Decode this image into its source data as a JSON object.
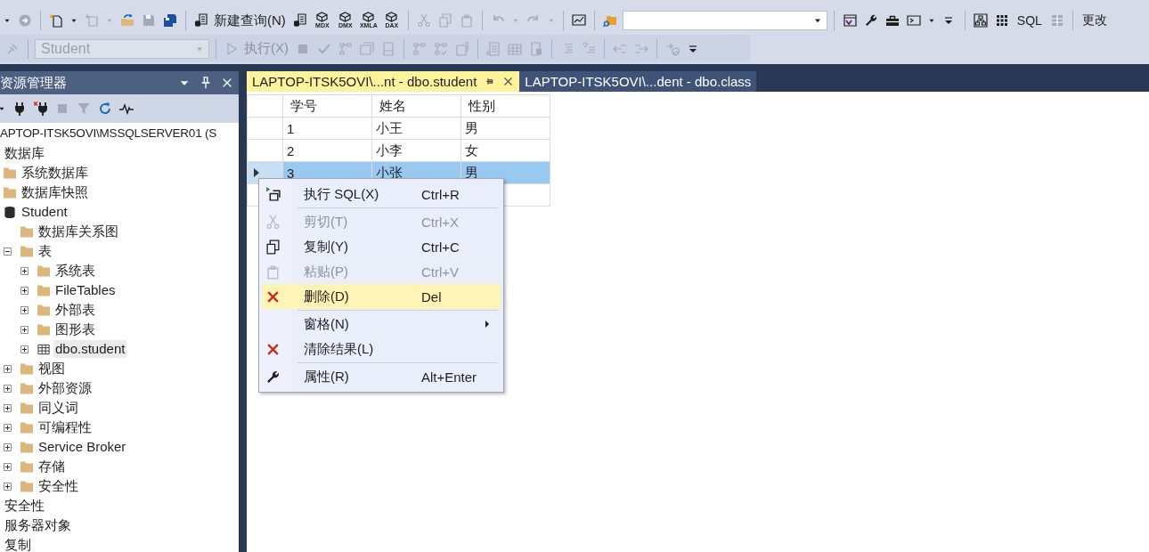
{
  "toolbars": [
    {
      "items": [
        {
          "kind": "caret",
          "disabled": false
        },
        {
          "kind": "forward-circle",
          "disabled": true
        },
        {
          "kind": "separator"
        },
        {
          "kind": "new-file",
          "disabled": false
        },
        {
          "kind": "caret",
          "disabled": false
        },
        {
          "kind": "add-item",
          "disabled": true
        },
        {
          "kind": "caret",
          "disabled": true
        },
        {
          "kind": "open-folder",
          "disabled": false
        },
        {
          "kind": "floppy-disk",
          "disabled": true
        },
        {
          "kind": "floppy-disks",
          "disabled": false
        },
        {
          "kind": "separator"
        },
        {
          "kind": "document-button",
          "label": "新建查询(N)",
          "disabled": false
        },
        {
          "kind": "document-db",
          "disabled": false
        },
        {
          "kind": "cube-button",
          "label": "MDX",
          "disabled": false
        },
        {
          "kind": "cube-button",
          "label": "DMX",
          "disabled": false
        },
        {
          "kind": "cube-button",
          "label": "XMLA",
          "disabled": false
        },
        {
          "kind": "cube-button",
          "label": "DAX",
          "disabled": false
        },
        {
          "kind": "separator"
        },
        {
          "kind": "scissors",
          "disabled": true
        },
        {
          "kind": "copy-pages",
          "disabled": true
        },
        {
          "kind": "clipboard",
          "disabled": true
        },
        {
          "kind": "separator"
        },
        {
          "kind": "undo-arrow",
          "disabled": true
        },
        {
          "kind": "caret",
          "disabled": true
        },
        {
          "kind": "redo-arrow",
          "disabled": true
        },
        {
          "kind": "caret",
          "disabled": true
        },
        {
          "kind": "separator"
        },
        {
          "kind": "monitor-chart",
          "disabled": false
        },
        {
          "kind": "separator"
        },
        {
          "kind": "search-folder",
          "disabled": false
        },
        {
          "kind": "combo",
          "disabled": false
        },
        {
          "kind": "separator"
        },
        {
          "kind": "window-logo",
          "disabled": false
        },
        {
          "kind": "wrench",
          "disabled": false
        },
        {
          "kind": "toolbox",
          "disabled": false
        },
        {
          "kind": "terminal",
          "disabled": false
        },
        {
          "kind": "caret",
          "disabled": false
        },
        {
          "kind": "overflow",
          "disabled": false
        },
        {
          "kind": "separator"
        },
        {
          "kind": "hierarchy",
          "disabled": false
        },
        {
          "kind": "dot-grid",
          "disabled": false
        },
        {
          "kind": "text-button",
          "label": "SQL",
          "disabled": false
        },
        {
          "kind": "grid-tile",
          "disabled": true
        },
        {
          "kind": "separator"
        },
        {
          "kind": "text-button",
          "label": "更改",
          "disabled": false
        }
      ]
    },
    {
      "items": [
        {
          "kind": "plug-tool",
          "disabled": true
        },
        {
          "kind": "separator"
        },
        {
          "kind": "combo",
          "value": "Student",
          "disabled": true
        },
        {
          "kind": "separator"
        },
        {
          "kind": "play-button",
          "label": "执行(X)",
          "disabled": true
        },
        {
          "kind": "stop-square",
          "disabled": true
        },
        {
          "kind": "checkmark",
          "disabled": true
        },
        {
          "kind": "flow-chart",
          "disabled": true
        },
        {
          "kind": "windows",
          "disabled": true
        },
        {
          "kind": "panel",
          "disabled": true
        },
        {
          "kind": "separator"
        },
        {
          "kind": "flow-chart",
          "disabled": true
        },
        {
          "kind": "flow-check",
          "disabled": true
        },
        {
          "kind": "panel-chart",
          "disabled": true
        },
        {
          "kind": "separator"
        },
        {
          "kind": "doc-list",
          "disabled": true
        },
        {
          "kind": "table-grid",
          "disabled": true
        },
        {
          "kind": "doc-link",
          "disabled": true
        },
        {
          "kind": "separator"
        },
        {
          "kind": "lines",
          "disabled": true
        },
        {
          "kind": "help-lines",
          "disabled": true
        },
        {
          "kind": "separator"
        },
        {
          "kind": "outdent",
          "disabled": true
        },
        {
          "kind": "indent",
          "disabled": true
        },
        {
          "kind": "separator"
        },
        {
          "kind": "at-arrow",
          "disabled": true
        },
        {
          "kind": "overflow",
          "disabled": false
        }
      ]
    }
  ],
  "explorer": {
    "title": "资源管理器",
    "toolbar": [
      {
        "kind": "caret",
        "disabled": false
      },
      {
        "kind": "plug",
        "disabled": false
      },
      {
        "kind": "plug-cross",
        "disabled": false
      },
      {
        "kind": "stop-square",
        "disabled": true
      },
      {
        "kind": "funnel",
        "disabled": true
      },
      {
        "kind": "refresh",
        "disabled": false
      },
      {
        "kind": "pulse",
        "disabled": false
      }
    ],
    "tree": [
      {
        "label": "APTOP-ITSK5OVI\\MSSQLSERVER01 (S",
        "selected": false,
        "children": [
          {
            "label": "数据库",
            "selected": false,
            "children": [
              {
                "label": "系统数据库",
                "kind": "folder",
                "selected": false
              },
              {
                "label": "数据库快照",
                "kind": "folder",
                "selected": false
              },
              {
                "label": "Student",
                "kind": "database",
                "selected": false,
                "children": [
                  {
                    "label": "数据库关系图",
                    "kind": "folder",
                    "selected": false
                  },
                  {
                    "label": "表",
                    "kind": "folder",
                    "selected": false,
                    "expanded": true,
                    "children": [
                      {
                        "label": "系统表",
                        "kind": "folder",
                        "selected": false,
                        "expanded": false
                      },
                      {
                        "label": "FileTables",
                        "kind": "folder",
                        "selected": false,
                        "expanded": false
                      },
                      {
                        "label": "外部表",
                        "kind": "folder",
                        "selected": false,
                        "expanded": false
                      },
                      {
                        "label": "图形表",
                        "kind": "folder",
                        "selected": false,
                        "expanded": false
                      },
                      {
                        "label": "dbo.student",
                        "kind": "table",
                        "selected": true,
                        "expanded": false
                      }
                    ]
                  },
                  {
                    "label": "视图",
                    "kind": "folder",
                    "selected": false,
                    "expanded": false
                  },
                  {
                    "label": "外部资源",
                    "kind": "folder",
                    "selected": false,
                    "expanded": false
                  },
                  {
                    "label": "同义词",
                    "kind": "folder",
                    "selected": false,
                    "expanded": false
                  },
                  {
                    "label": "可编程性",
                    "kind": "folder",
                    "selected": false,
                    "expanded": false
                  },
                  {
                    "label": "Service Broker",
                    "kind": "folder",
                    "selected": false,
                    "expanded": false
                  },
                  {
                    "label": "存储",
                    "kind": "folder",
                    "selected": false,
                    "expanded": false
                  },
                  {
                    "label": "安全性",
                    "kind": "folder",
                    "selected": false,
                    "expanded": false
                  }
                ]
              }
            ]
          },
          {
            "label": "安全性",
            "selected": false
          },
          {
            "label": "服务器对象",
            "selected": false
          },
          {
            "label": "复制",
            "selected": false
          }
        ]
      }
    ]
  },
  "tabs": [
    {
      "label": "LAPTOP-ITSK5OVI\\...nt - dbo.student",
      "selected": true
    },
    {
      "label": "LAPTOP-ITSK5OVI\\...dent - dbo.class",
      "selected": false
    }
  ],
  "grid": {
    "columns": [
      "学号",
      "姓名",
      "性别"
    ],
    "rows": [
      {
        "cells": [
          "1",
          "小王",
          "男"
        ],
        "selected": false
      },
      {
        "cells": [
          "2",
          "小李",
          "女"
        ],
        "selected": false
      },
      {
        "cells": [
          "3",
          "小张",
          "男"
        ],
        "selected": true
      }
    ]
  },
  "context_menu": {
    "items": [
      {
        "kind": "run",
        "label": "执行 SQL(X)",
        "shortcut": "Ctrl+R",
        "disabled": false,
        "selected": false
      },
      {
        "kind": "separator"
      },
      {
        "kind": "cut",
        "label": "剪切(T)",
        "shortcut": "Ctrl+X",
        "disabled": true,
        "selected": false
      },
      {
        "kind": "copy",
        "label": "复制(Y)",
        "shortcut": "Ctrl+C",
        "disabled": false,
        "selected": false
      },
      {
        "kind": "paste",
        "label": "粘贴(P)",
        "shortcut": "Ctrl+V",
        "disabled": true,
        "selected": false
      },
      {
        "kind": "delete",
        "label": "删除(D)",
        "shortcut": "Del",
        "disabled": false,
        "selected": true
      },
      {
        "kind": "separator"
      },
      {
        "kind": "submenu",
        "label": "窗格(N)",
        "disabled": false,
        "selected": false
      },
      {
        "kind": "clear",
        "label": "清除结果(L)",
        "disabled": false,
        "selected": false
      },
      {
        "kind": "separator"
      },
      {
        "kind": "properties",
        "label": "属性(R)",
        "shortcut": "Alt+Enter",
        "disabled": false,
        "selected": false
      }
    ]
  }
}
